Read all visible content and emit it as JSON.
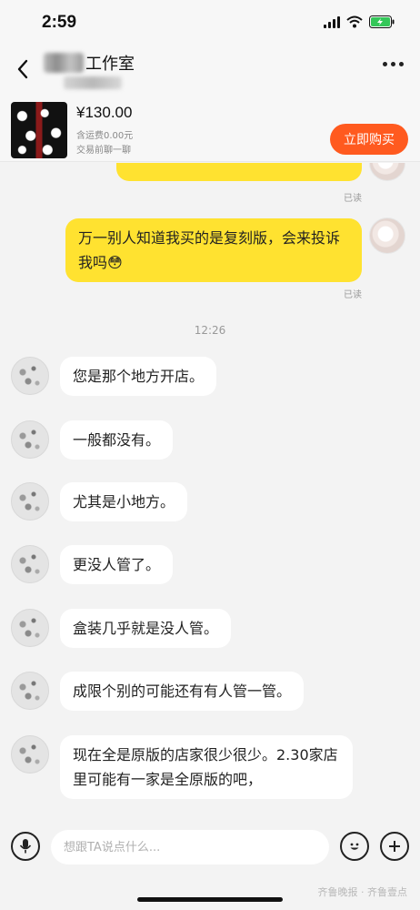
{
  "status": {
    "time": "2:59"
  },
  "header": {
    "title_suffix": "工作室"
  },
  "product": {
    "price": "¥130.00",
    "shipping": "含运费0.00元",
    "pre_chat": "交易前聊一聊",
    "buy_label": "立即购买"
  },
  "messages_out": [
    {
      "text": "万一别人知道我买的是复刻版，会来投诉我吗😳",
      "status": "已读"
    }
  ],
  "partial_read": "已读",
  "time_sep": "12:26",
  "messages_in": [
    {
      "text": "您是那个地方开店。"
    },
    {
      "text": "一般都没有。"
    },
    {
      "text": "尤其是小地方。"
    },
    {
      "text": "更没人管了。"
    },
    {
      "text": "盒装几乎就是没人管。"
    },
    {
      "text": "成限个别的可能还有有人管一管。"
    },
    {
      "text": "现在全是原版的店家很少很少。2.30家店里可能有一家是全原版的吧，"
    }
  ],
  "input": {
    "placeholder": "想跟TA说点什么..."
  },
  "watermark": "齐鲁晚报 · 齐鲁壹点",
  "colors": {
    "accent_yellow": "#ffe230",
    "buy_orange": "#ff5a1f"
  }
}
